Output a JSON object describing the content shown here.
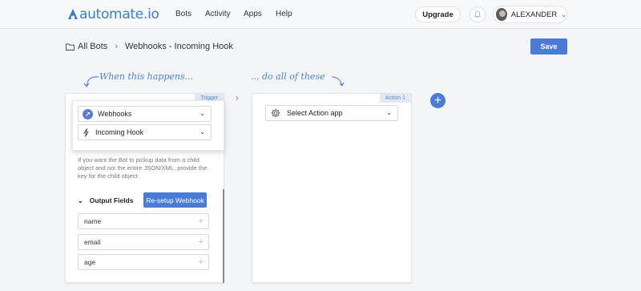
{
  "header": {
    "logo_text": "automate.io",
    "nav": [
      "Bots",
      "Activity",
      "Apps",
      "Help"
    ],
    "upgrade_label": "Upgrade",
    "user_name": "ALEXANDER"
  },
  "breadcrumb": {
    "root": "All Bots",
    "current": "Webhooks - Incoming Hook"
  },
  "save_label": "Save",
  "handwriting": {
    "trigger_hint": "When this happens...",
    "action_hint": "... do all of these"
  },
  "trigger": {
    "tag": "Trigger",
    "app": "Webhooks",
    "event": "Incoming Hook",
    "help_text": "If you want the Bot to pickup data from a child object and not the entire JSON/XML, provide the key for the child object",
    "output_fields_label": "Output Fields",
    "resetup_label": "Re-setup Webhook",
    "fields": [
      "name",
      "email",
      "age"
    ]
  },
  "action": {
    "tag": "Action 1",
    "placeholder": "Select Action app"
  },
  "colors": {
    "accent": "#4a7bd6",
    "logo": "#3d7cc9",
    "handwriting": "#4b82d0"
  },
  "icons": [
    "automate-logo-icon",
    "bell-icon",
    "folder-icon",
    "link-icon",
    "bolt-icon",
    "gear-icon",
    "plus-icon",
    "chevron-down-icon"
  ]
}
